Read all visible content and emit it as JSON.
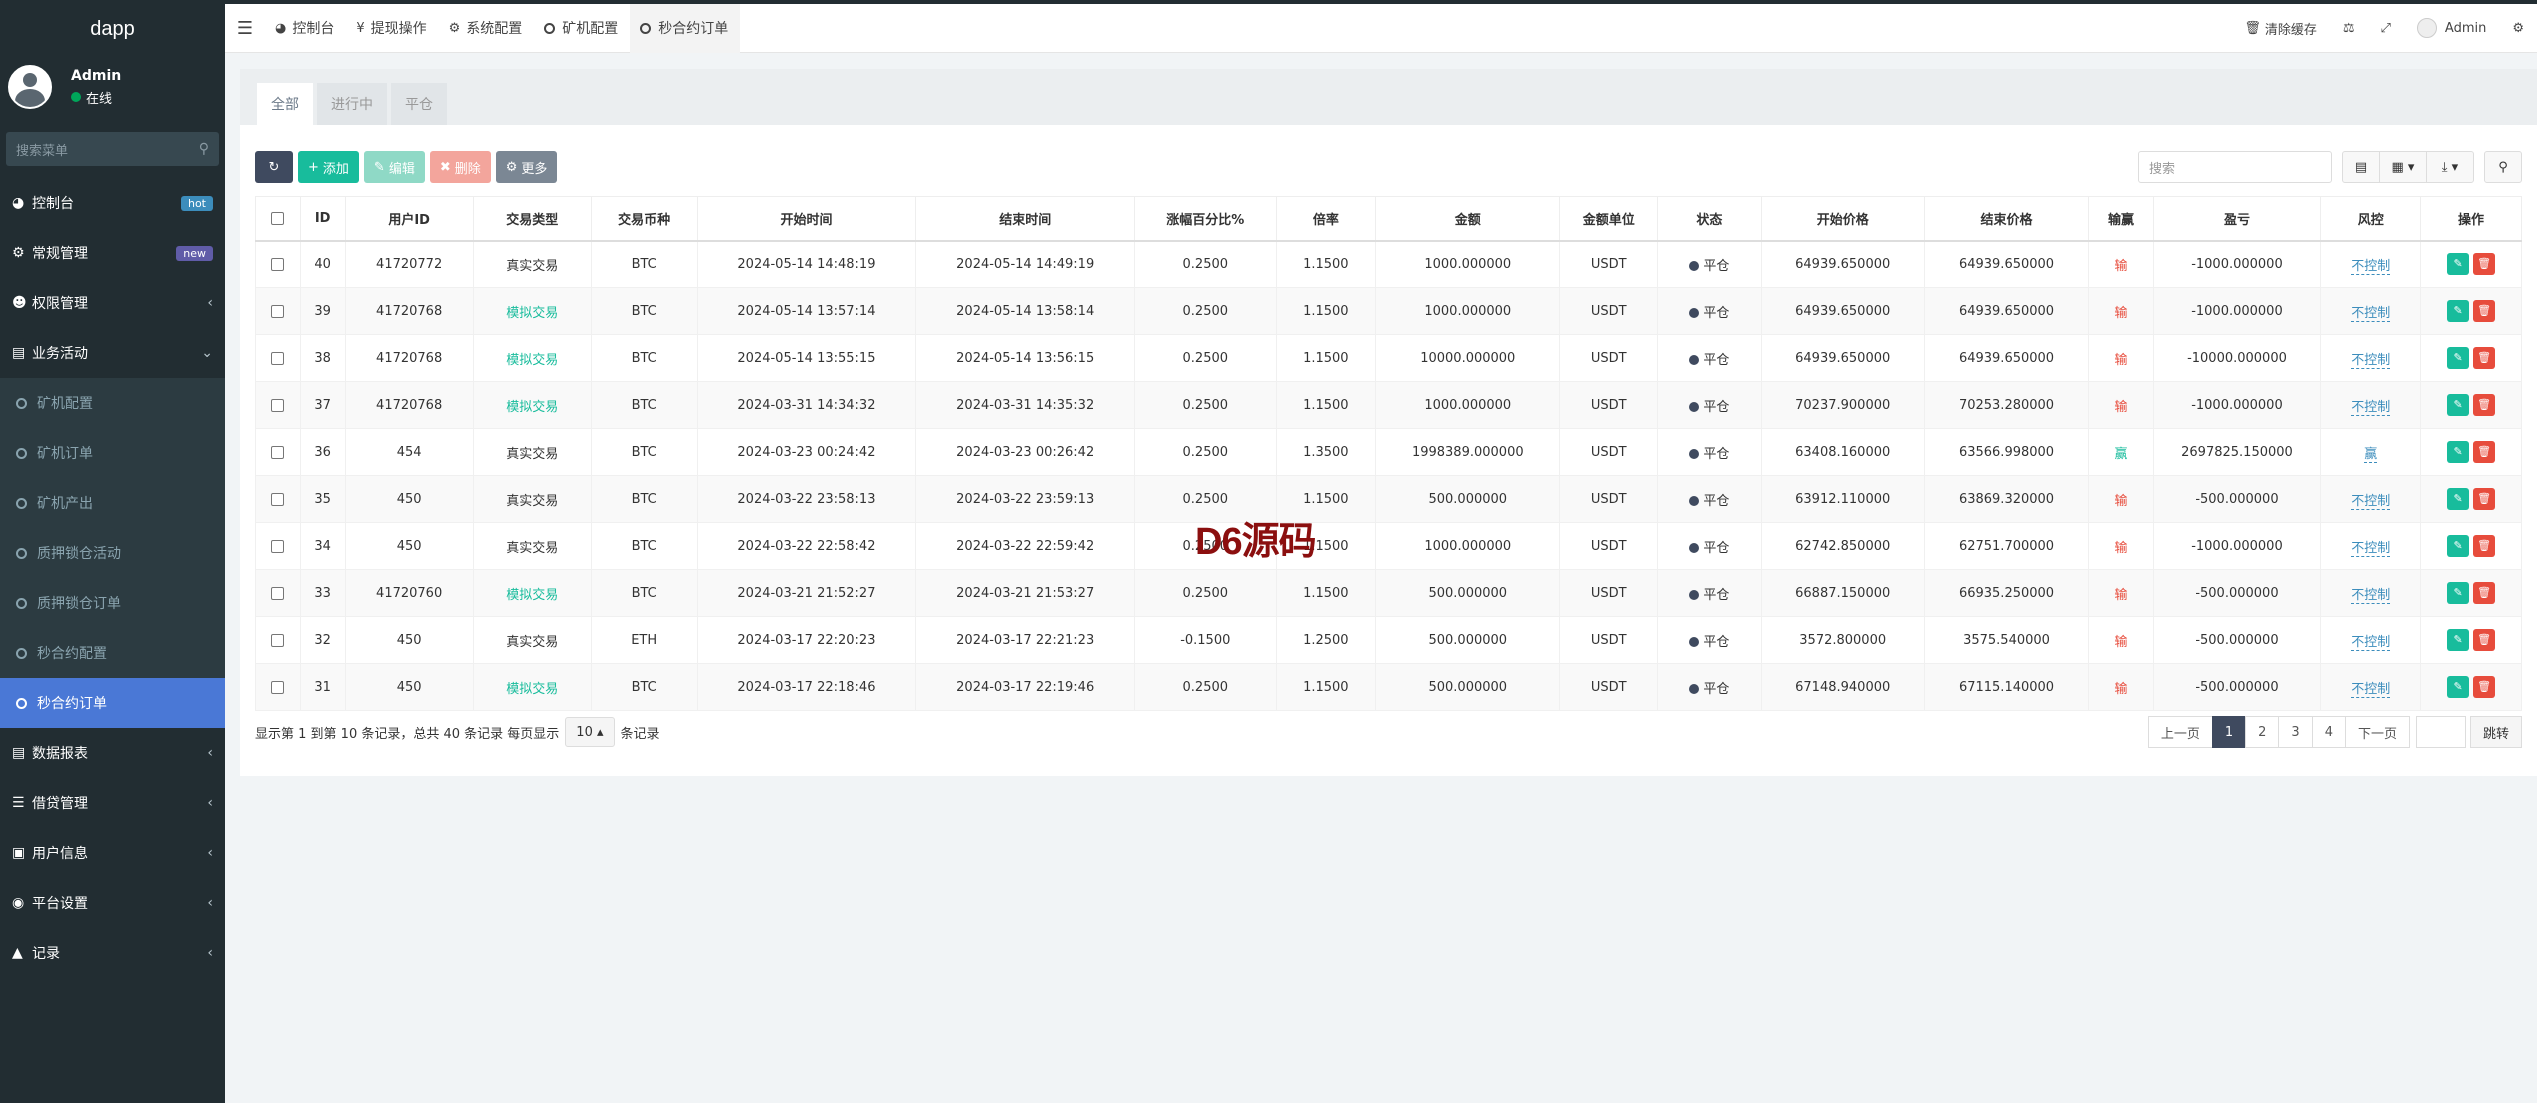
{
  "brand": "dapp",
  "user": {
    "name": "Admin",
    "status": "在线"
  },
  "sidebar_search": {
    "placeholder": "搜索菜单"
  },
  "menu": {
    "dashboard": {
      "label": "控制台",
      "badge": "hot"
    },
    "general": {
      "label": "常规管理",
      "badge": "new"
    },
    "permission": {
      "label": "权限管理"
    },
    "business": {
      "label": "业务活动"
    },
    "sub": [
      "矿机配置",
      "矿机订单",
      "矿机产出",
      "质押锁仓活动",
      "质押锁仓订单",
      "秒合约配置",
      "秒合约订单"
    ],
    "reports": {
      "label": "数据报表"
    },
    "loan": {
      "label": "借贷管理"
    },
    "userinfo": {
      "label": "用户信息"
    },
    "platform": {
      "label": "平台设置"
    },
    "records": {
      "label": "记录"
    }
  },
  "header": {
    "tabs": [
      "控制台",
      "提现操作",
      "系统配置",
      "矿机配置",
      "秒合约订单"
    ],
    "clear_cache": "清除缓存",
    "admin": "Admin"
  },
  "panel_tabs": [
    "全部",
    "进行中",
    "平仓"
  ],
  "toolbar": {
    "add": "添加",
    "edit": "编辑",
    "delete": "删除",
    "more": "更多",
    "search_placeholder": "搜索"
  },
  "table": {
    "headers": [
      "ID",
      "用户ID",
      "交易类型",
      "交易币种",
      "开始时间",
      "结束时间",
      "涨幅百分比%",
      "倍率",
      "金额",
      "金额单位",
      "状态",
      "开始价格",
      "结束价格",
      "输赢",
      "盈亏",
      "风控",
      "操作"
    ],
    "rows": [
      {
        "id": "40",
        "uid": "41720772",
        "type": "真实交易",
        "sim": false,
        "coin": "BTC",
        "start": "2024-05-14 14:48:19",
        "end": "2024-05-14 14:49:19",
        "pct": "0.2500",
        "rate": "1.1500",
        "amount": "1000.000000",
        "unit": "USDT",
        "status": "平仓",
        "sp": "64939.650000",
        "ep": "64939.650000",
        "result": "输",
        "win": false,
        "pnl": "-1000.000000",
        "ctrl": "不控制"
      },
      {
        "id": "39",
        "uid": "41720768",
        "type": "模拟交易",
        "sim": true,
        "coin": "BTC",
        "start": "2024-05-14 13:57:14",
        "end": "2024-05-14 13:58:14",
        "pct": "0.2500",
        "rate": "1.1500",
        "amount": "1000.000000",
        "unit": "USDT",
        "status": "平仓",
        "sp": "64939.650000",
        "ep": "64939.650000",
        "result": "输",
        "win": false,
        "pnl": "-1000.000000",
        "ctrl": "不控制"
      },
      {
        "id": "38",
        "uid": "41720768",
        "type": "模拟交易",
        "sim": true,
        "coin": "BTC",
        "start": "2024-05-14 13:55:15",
        "end": "2024-05-14 13:56:15",
        "pct": "0.2500",
        "rate": "1.1500",
        "amount": "10000.000000",
        "unit": "USDT",
        "status": "平仓",
        "sp": "64939.650000",
        "ep": "64939.650000",
        "result": "输",
        "win": false,
        "pnl": "-10000.000000",
        "ctrl": "不控制"
      },
      {
        "id": "37",
        "uid": "41720768",
        "type": "模拟交易",
        "sim": true,
        "coin": "BTC",
        "start": "2024-03-31 14:34:32",
        "end": "2024-03-31 14:35:32",
        "pct": "0.2500",
        "rate": "1.1500",
        "amount": "1000.000000",
        "unit": "USDT",
        "status": "平仓",
        "sp": "70237.900000",
        "ep": "70253.280000",
        "result": "输",
        "win": false,
        "pnl": "-1000.000000",
        "ctrl": "不控制"
      },
      {
        "id": "36",
        "uid": "454",
        "type": "真实交易",
        "sim": false,
        "coin": "BTC",
        "start": "2024-03-23 00:24:42",
        "end": "2024-03-23 00:26:42",
        "pct": "0.2500",
        "rate": "1.3500",
        "amount": "1998389.000000",
        "unit": "USDT",
        "status": "平仓",
        "sp": "63408.160000",
        "ep": "63566.998000",
        "result": "赢",
        "win": true,
        "pnl": "2697825.150000",
        "ctrl": "赢"
      },
      {
        "id": "35",
        "uid": "450",
        "type": "真实交易",
        "sim": false,
        "coin": "BTC",
        "start": "2024-03-22 23:58:13",
        "end": "2024-03-22 23:59:13",
        "pct": "0.2500",
        "rate": "1.1500",
        "amount": "500.000000",
        "unit": "USDT",
        "status": "平仓",
        "sp": "63912.110000",
        "ep": "63869.320000",
        "result": "输",
        "win": false,
        "pnl": "-500.000000",
        "ctrl": "不控制"
      },
      {
        "id": "34",
        "uid": "450",
        "type": "真实交易",
        "sim": false,
        "coin": "BTC",
        "start": "2024-03-22 22:58:42",
        "end": "2024-03-22 22:59:42",
        "pct": "0.2500",
        "rate": "1.1500",
        "amount": "1000.000000",
        "unit": "USDT",
        "status": "平仓",
        "sp": "62742.850000",
        "ep": "62751.700000",
        "result": "输",
        "win": false,
        "pnl": "-1000.000000",
        "ctrl": "不控制"
      },
      {
        "id": "33",
        "uid": "41720760",
        "type": "模拟交易",
        "sim": true,
        "coin": "BTC",
        "start": "2024-03-21 21:52:27",
        "end": "2024-03-21 21:53:27",
        "pct": "0.2500",
        "rate": "1.1500",
        "amount": "500.000000",
        "unit": "USDT",
        "status": "平仓",
        "sp": "66887.150000",
        "ep": "66935.250000",
        "result": "输",
        "win": false,
        "pnl": "-500.000000",
        "ctrl": "不控制"
      },
      {
        "id": "32",
        "uid": "450",
        "type": "真实交易",
        "sim": false,
        "coin": "ETH",
        "start": "2024-03-17 22:20:23",
        "end": "2024-03-17 22:21:23",
        "pct": "-0.1500",
        "rate": "1.2500",
        "amount": "500.000000",
        "unit": "USDT",
        "status": "平仓",
        "sp": "3572.800000",
        "ep": "3575.540000",
        "result": "输",
        "win": false,
        "pnl": "-500.000000",
        "ctrl": "不控制"
      },
      {
        "id": "31",
        "uid": "450",
        "type": "模拟交易",
        "sim": true,
        "coin": "BTC",
        "start": "2024-03-17 22:18:46",
        "end": "2024-03-17 22:19:46",
        "pct": "0.2500",
        "rate": "1.1500",
        "amount": "500.000000",
        "unit": "USDT",
        "status": "平仓",
        "sp": "67148.940000",
        "ep": "67115.140000",
        "result": "输",
        "win": false,
        "pnl": "-500.000000",
        "ctrl": "不控制"
      }
    ]
  },
  "footer": {
    "summary": "显示第 1 到第 10 条记录，总共 40 条记录 每页显示",
    "page_size": "10",
    "suffix": "条记录",
    "prev": "上一页",
    "pages": [
      "1",
      "2",
      "3",
      "4"
    ],
    "next": "下一页",
    "jump": "跳转"
  },
  "watermark": "D6源码"
}
